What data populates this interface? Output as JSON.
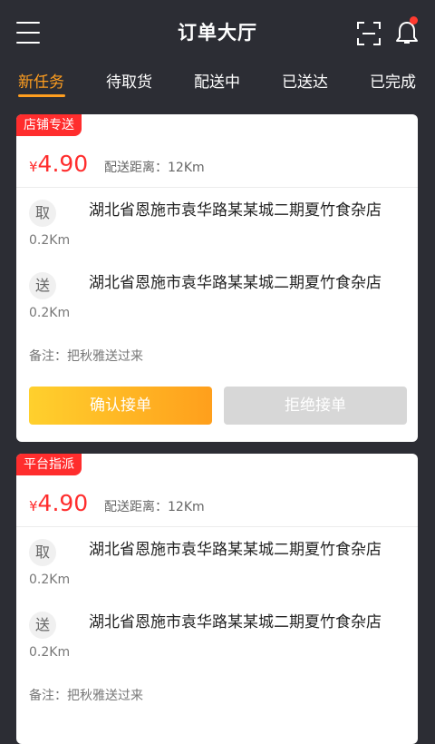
{
  "header": {
    "title": "订单大厅",
    "icons": {
      "menu": "menu-icon",
      "scan": "scan-icon",
      "notifications": "bell-icon"
    },
    "notification_dot": true
  },
  "tabs": [
    {
      "label": "新任务",
      "active": true
    },
    {
      "label": "待取货",
      "active": false
    },
    {
      "label": "配送中",
      "active": false
    },
    {
      "label": "已送达",
      "active": false
    },
    {
      "label": "已完成",
      "active": false
    }
  ],
  "orders": [
    {
      "badge": "店铺专送",
      "currency": "¥",
      "price": "4.90",
      "distance": "配送距离：12Km",
      "pickup": {
        "tag": "取",
        "distance": "0.2Km",
        "address": "湖北省恩施市袁华路某某城二期夏竹食杂店"
      },
      "delivery": {
        "tag": "送",
        "distance": "0.2Km",
        "address": "湖北省恩施市袁华路某某城二期夏竹食杂店"
      },
      "note": "备注：把秋雅送过来",
      "confirm_label": "确认接单",
      "reject_label": "拒绝接单"
    },
    {
      "badge": "平台指派",
      "currency": "¥",
      "price": "4.90",
      "distance": "配送距离：12Km",
      "pickup": {
        "tag": "取",
        "distance": "0.2Km",
        "address": "湖北省恩施市袁华路某某城二期夏竹食杂店"
      },
      "delivery": {
        "tag": "送",
        "distance": "0.2Km",
        "address": "湖北省恩施市袁华路某某城二期夏竹食杂店"
      },
      "note": "备注：把秋雅送过来"
    }
  ],
  "colors": {
    "background": "#2c2d34",
    "accent": "#ff9e1f",
    "price": "#ff2d2d",
    "badge": "#ff2d2d",
    "reject_button": "#d7d7d7"
  }
}
